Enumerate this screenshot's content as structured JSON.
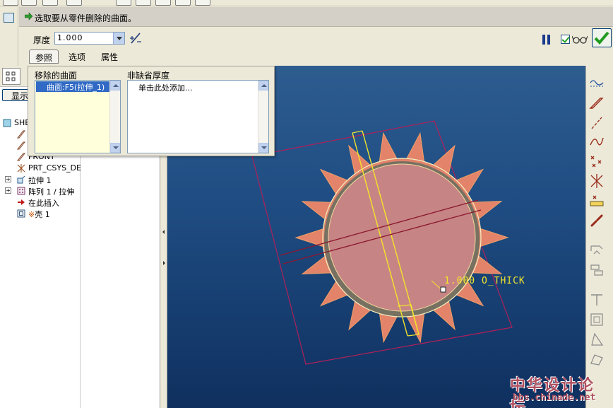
{
  "dashboard": {
    "prompt": "选取要从零件删除的曲面。",
    "thickness_label": "厚度",
    "thickness_value": "1.000",
    "tabs": [
      {
        "label": "参照"
      },
      {
        "label": "选项"
      },
      {
        "label": "属性"
      }
    ],
    "preview_checked": true
  },
  "references_panel": {
    "removed_surfaces_label": "移除的曲面",
    "removed_surfaces_items": [
      "曲面:F5(拉伸_1)"
    ],
    "non_default_label": "非缺省厚度",
    "non_default_placeholder": "单击此处添加..."
  },
  "model_tree": {
    "show_button": "显示",
    "items": [
      {
        "label": "SHE",
        "icon": "part-icon"
      },
      {
        "label": "",
        "icon": "datum-plane-icon"
      },
      {
        "label": "",
        "icon": "datum-plane-icon"
      },
      {
        "label": "FRONT",
        "icon": "datum-plane-icon"
      },
      {
        "label": "PRT_CSYS_DE",
        "icon": "csys-icon"
      },
      {
        "label": "拉伸 1",
        "icon": "extrude-icon"
      },
      {
        "label": "阵列 1 / 拉伸",
        "icon": "pattern-icon"
      },
      {
        "label": "在此插入",
        "icon": "insert-here-icon"
      },
      {
        "label": "壳 1",
        "icon": "shell-icon"
      }
    ]
  },
  "graphics": {
    "dimension_text": "1.000 O_THICK"
  },
  "watermark": {
    "title": "中华设计论坛",
    "url": "bbs.chinade.net"
  }
}
